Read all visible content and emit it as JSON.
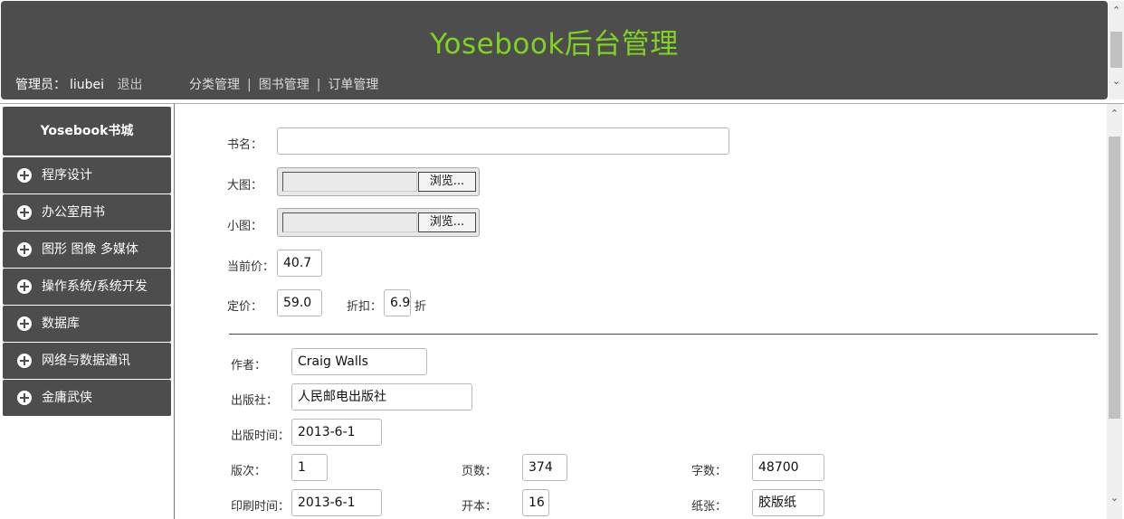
{
  "header": {
    "title": "Yosebook后台管理",
    "admin_label": "管理员：",
    "admin_name": "liubei",
    "logout": "退出",
    "nav": [
      "分类管理",
      "图书管理",
      "订单管理"
    ],
    "title_color": "#7fd321"
  },
  "sidebar": {
    "title": "Yosebook书城",
    "items": [
      {
        "label": "程序设计",
        "icon": "plus-circle-icon"
      },
      {
        "label": "办公室用书",
        "icon": "plus-circle-icon"
      },
      {
        "label": "图形 图像 多媒体",
        "icon": "plus-circle-icon"
      },
      {
        "label": "操作系统/系统开发",
        "icon": "plus-circle-icon"
      },
      {
        "label": "数据库",
        "icon": "plus-circle-icon"
      },
      {
        "label": "网络与数据通讯",
        "icon": "plus-circle-icon"
      },
      {
        "label": "金庸武侠",
        "icon": "plus-circle-icon"
      }
    ]
  },
  "form": {
    "book_name": {
      "label": "书名：",
      "value": ""
    },
    "big_image": {
      "label": "大图：",
      "button": "浏览..."
    },
    "small_image": {
      "label": "小图：",
      "button": "浏览..."
    },
    "current_price": {
      "label": "当前价：",
      "value": "40.7"
    },
    "list_price": {
      "label": "定价：",
      "value": "59.0"
    },
    "discount": {
      "label": "折扣：",
      "value": "6.9",
      "unit": "折"
    },
    "author": {
      "label": "作者：",
      "value": "Craig Walls"
    },
    "publisher": {
      "label": "出版社：",
      "value": "人民邮电出版社"
    },
    "publish_time": {
      "label": "出版时间：",
      "value": "2013-6-1"
    },
    "edition": {
      "label": "版次：",
      "value": "1"
    },
    "pages": {
      "label": "页数：",
      "value": "374"
    },
    "words": {
      "label": "字数：",
      "value": "48700"
    },
    "print_time": {
      "label": "印刷时间：",
      "value": "2013-6-1"
    },
    "format": {
      "label": "开本：",
      "value": "16"
    },
    "paper": {
      "label": "纸张：",
      "value": "胶版纸"
    }
  }
}
